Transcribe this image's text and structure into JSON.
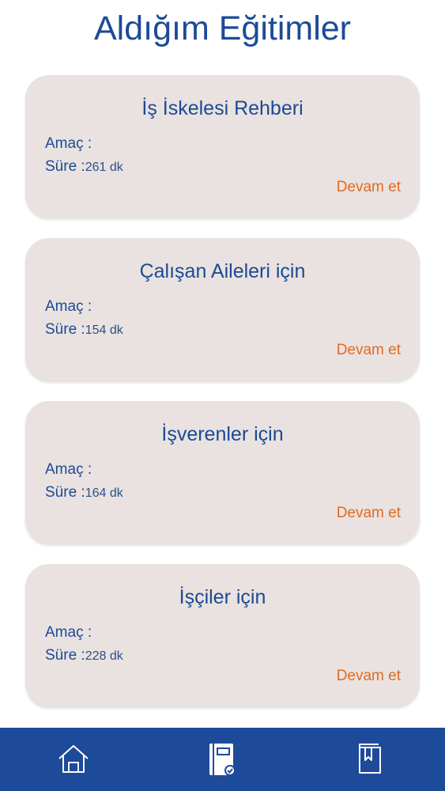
{
  "page": {
    "title": "Aldığım Eğitimler"
  },
  "courses": [
    {
      "title": "İş İskelesi Rehberi",
      "purpose_label": "Amaç :",
      "duration_label": "Süre :",
      "duration_value": "261 dk",
      "action_label": "Devam et"
    },
    {
      "title": "Çalışan Aileleri için",
      "purpose_label": "Amaç :",
      "duration_label": "Süre :",
      "duration_value": "154 dk",
      "action_label": "Devam et"
    },
    {
      "title": "İşverenler için",
      "purpose_label": "Amaç :",
      "duration_label": "Süre :",
      "duration_value": "164 dk",
      "action_label": "Devam et"
    },
    {
      "title": "İşçiler için",
      "purpose_label": "Amaç :",
      "duration_label": "Süre :",
      "duration_value": "228 dk",
      "action_label": "Devam et"
    }
  ],
  "bottom_nav": {
    "items": [
      {
        "icon": "home-icon"
      },
      {
        "icon": "notebook-check-icon",
        "active": true
      },
      {
        "icon": "book-icon"
      }
    ]
  },
  "colors": {
    "primary": "#1c4a96",
    "nav_background": "#1e4a9a",
    "card_background": "#e9e2e0",
    "accent": "#e36a1e"
  }
}
